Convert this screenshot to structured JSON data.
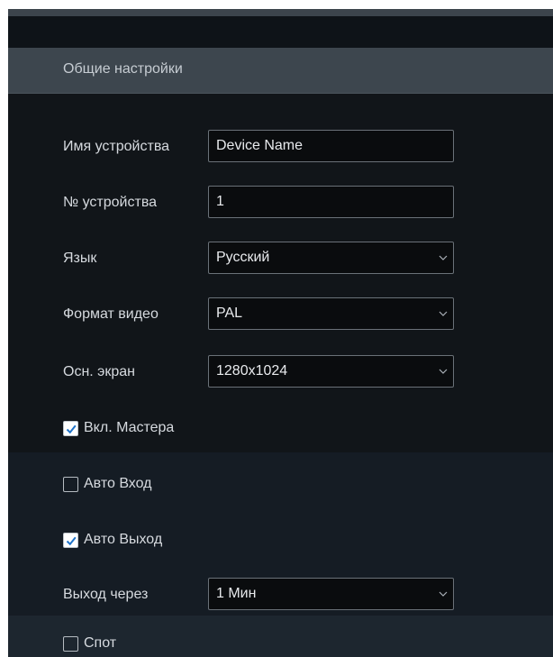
{
  "section": {
    "title": "Общие настройки"
  },
  "fields": {
    "device_name": {
      "label": "Имя устройства",
      "value": "Device Name"
    },
    "device_no": {
      "label": "№ устройства",
      "value": "1"
    },
    "language": {
      "label": "Язык",
      "value": "Русский"
    },
    "video_format": {
      "label": "Формат видео",
      "value": "PAL"
    },
    "main_screen": {
      "label": "Осн. экран",
      "value": "1280x1024"
    },
    "logout_after": {
      "label": "Выход через",
      "value": "1 Мин"
    }
  },
  "checkboxes": {
    "wizard": {
      "label": "Вкл. Мастера",
      "checked": true
    },
    "auto_login": {
      "label": "Авто Вход",
      "checked": false
    },
    "auto_logout": {
      "label": "Авто Выход",
      "checked": true
    },
    "spot": {
      "label": "Спот",
      "checked": false
    }
  },
  "colors": {
    "header_bg": "#3d464e",
    "panel_bg": "#111519",
    "check_color": "#1f73c9"
  },
  "icons": {
    "check": "checkmark-icon",
    "dropdown": "chevron-down-icon"
  }
}
